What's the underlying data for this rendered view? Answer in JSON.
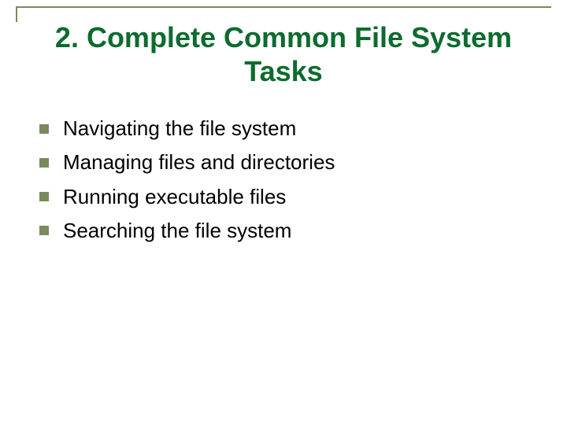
{
  "slide": {
    "title": "2.  Complete Common File System Tasks",
    "bullets": [
      {
        "text": "Navigating the file system"
      },
      {
        "text": "Managing files and directories"
      },
      {
        "text": "Running executable files"
      },
      {
        "text": "Searching the file system"
      }
    ]
  },
  "colors": {
    "title": "#0d6b2e",
    "accent": "#7a8a5a"
  }
}
